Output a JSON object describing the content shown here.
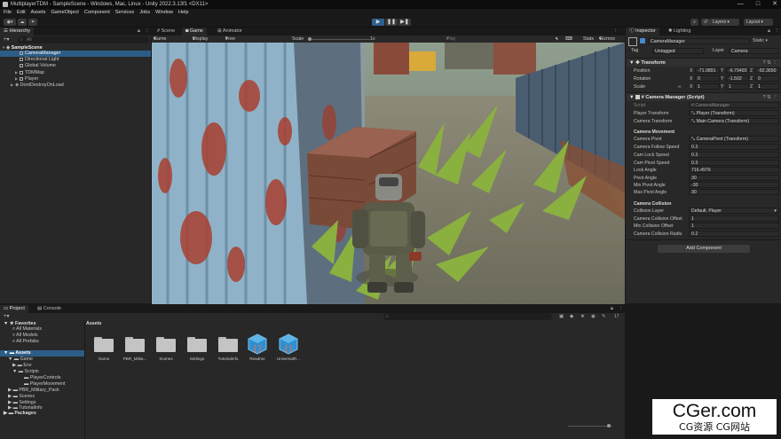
{
  "title": "MultiplayerTDM - SampleScene - Windows, Mac, Linux - Unity 2022.3.13f1 <DX11>",
  "window_controls": [
    "—",
    "□",
    "✕"
  ],
  "menu": [
    "File",
    "Edit",
    "Assets",
    "GameObject",
    "Component",
    "Services",
    "Jobs",
    "Window",
    "Help"
  ],
  "toolbar": {
    "layers": "Layers",
    "layout": "Layout"
  },
  "hierarchy": {
    "tab": "Hierarchy",
    "search_placeholder": "All",
    "items": [
      {
        "label": "SampleScene"
      },
      {
        "label": "CameraManager"
      },
      {
        "label": "Directional Light"
      },
      {
        "label": "Global Volume"
      },
      {
        "label": "TDMMap"
      },
      {
        "label": "Player"
      },
      {
        "label": "DontDestroyOnLoad"
      }
    ]
  },
  "scene_tabs": [
    "Scene",
    "Game",
    "Animator"
  ],
  "gamebar": {
    "mode": "Game",
    "display": "Display 1",
    "aspect": "Free Aspect",
    "scale_label": "Scale",
    "scale_value": "1x",
    "play_focused": "Play Focused",
    "stats": "Stats",
    "gizmos": "Gizmos"
  },
  "inspector": {
    "tabs": [
      "Inspector",
      "Lighting"
    ],
    "object_name": "CameraManager",
    "static_label": "Static",
    "tag_label": "Tag",
    "tag_value": "Untagged",
    "layer_label": "Layer",
    "layer_value": "Camera",
    "transform": {
      "header": "Transform",
      "position_label": "Position",
      "rotation_label": "Rotation",
      "scale_label": "Scale",
      "position": {
        "x": "-71.0891",
        "y": "-6.79493",
        "z": "-92.3650"
      },
      "rotation": {
        "x": "0",
        "y": "-1.502",
        "z": "0"
      },
      "scale": {
        "x": "1",
        "y": "1",
        "z": "1"
      }
    },
    "camera_manager": {
      "header": "Camera Manager (Script)",
      "script_label": "Script",
      "script_value": "CameraManager",
      "player_transform_label": "Player Transform",
      "player_transform_value": "Player (Transform)",
      "camera_transform_label": "Camera Transform",
      "camera_transform_value": "Main Camera (Transform)",
      "movement_header": "Camera Movement",
      "camera_pivot_label": "Camera Pivot",
      "camera_pivot_value": "CameraPivot (Transform)",
      "follow_speed_label": "Camera Follow Speed",
      "follow_speed_value": "0.3",
      "lock_speed_label": "Cam Lock Speed",
      "lock_speed_value": "0.3",
      "pivot_speed_label": "Cam Pivot Speed",
      "pivot_speed_value": "0.3",
      "look_angle_label": "Look Angle",
      "look_angle_value": "716.4976",
      "pivot_angle_label": "Pivot Angle",
      "pivot_angle_value": "30",
      "min_pivot_label": "Min Pivot Angle",
      "min_pivot_value": "-30",
      "max_pivot_label": "Max Pivot Angle",
      "max_pivot_value": "30",
      "collision_header": "Camera Collision",
      "collision_layer_label": "Collision Layer",
      "collision_layer_value": "Default, Player",
      "collision_offset_label": "Camera Collision Offset",
      "collision_offset_value": "1",
      "min_collision_offset_label": "Min Collision Offset",
      "min_collision_offset_value": "1",
      "collision_radius_label": "Camera Collision Radiu",
      "collision_radius_value": "0.2"
    },
    "add_component": "Add Component"
  },
  "project": {
    "tabs": [
      "Project",
      "Console"
    ],
    "count": "17",
    "favorites": {
      "label": "Favorites",
      "items": [
        "All Materials",
        "All Models",
        "All Prefabs"
      ]
    },
    "assets_tree": {
      "label": "Assets",
      "game": "Game",
      "env": "Env",
      "scripts": "Scripts",
      "player_controls": "PlayerControls",
      "player_movement": "PlayerMovement",
      "pbr": "PBR_Military_Pack",
      "scenes": "Scenes",
      "settings": "Settings",
      "tutorial": "TutorialInfo"
    },
    "packages": "Packages",
    "breadcrumb": "Assets",
    "assets": [
      {
        "label": "Game",
        "kind": "folder"
      },
      {
        "label": "PBR_Milita...",
        "kind": "folder"
      },
      {
        "label": "Scenes",
        "kind": "folder"
      },
      {
        "label": "Settings",
        "kind": "folder"
      },
      {
        "label": "TutorialInfo",
        "kind": "folder"
      },
      {
        "label": "Readme",
        "kind": "script"
      },
      {
        "label": "UniversalR...",
        "kind": "script"
      }
    ]
  },
  "watermark": {
    "main": "CGer.com",
    "sub": "CG资源 CG网站"
  }
}
